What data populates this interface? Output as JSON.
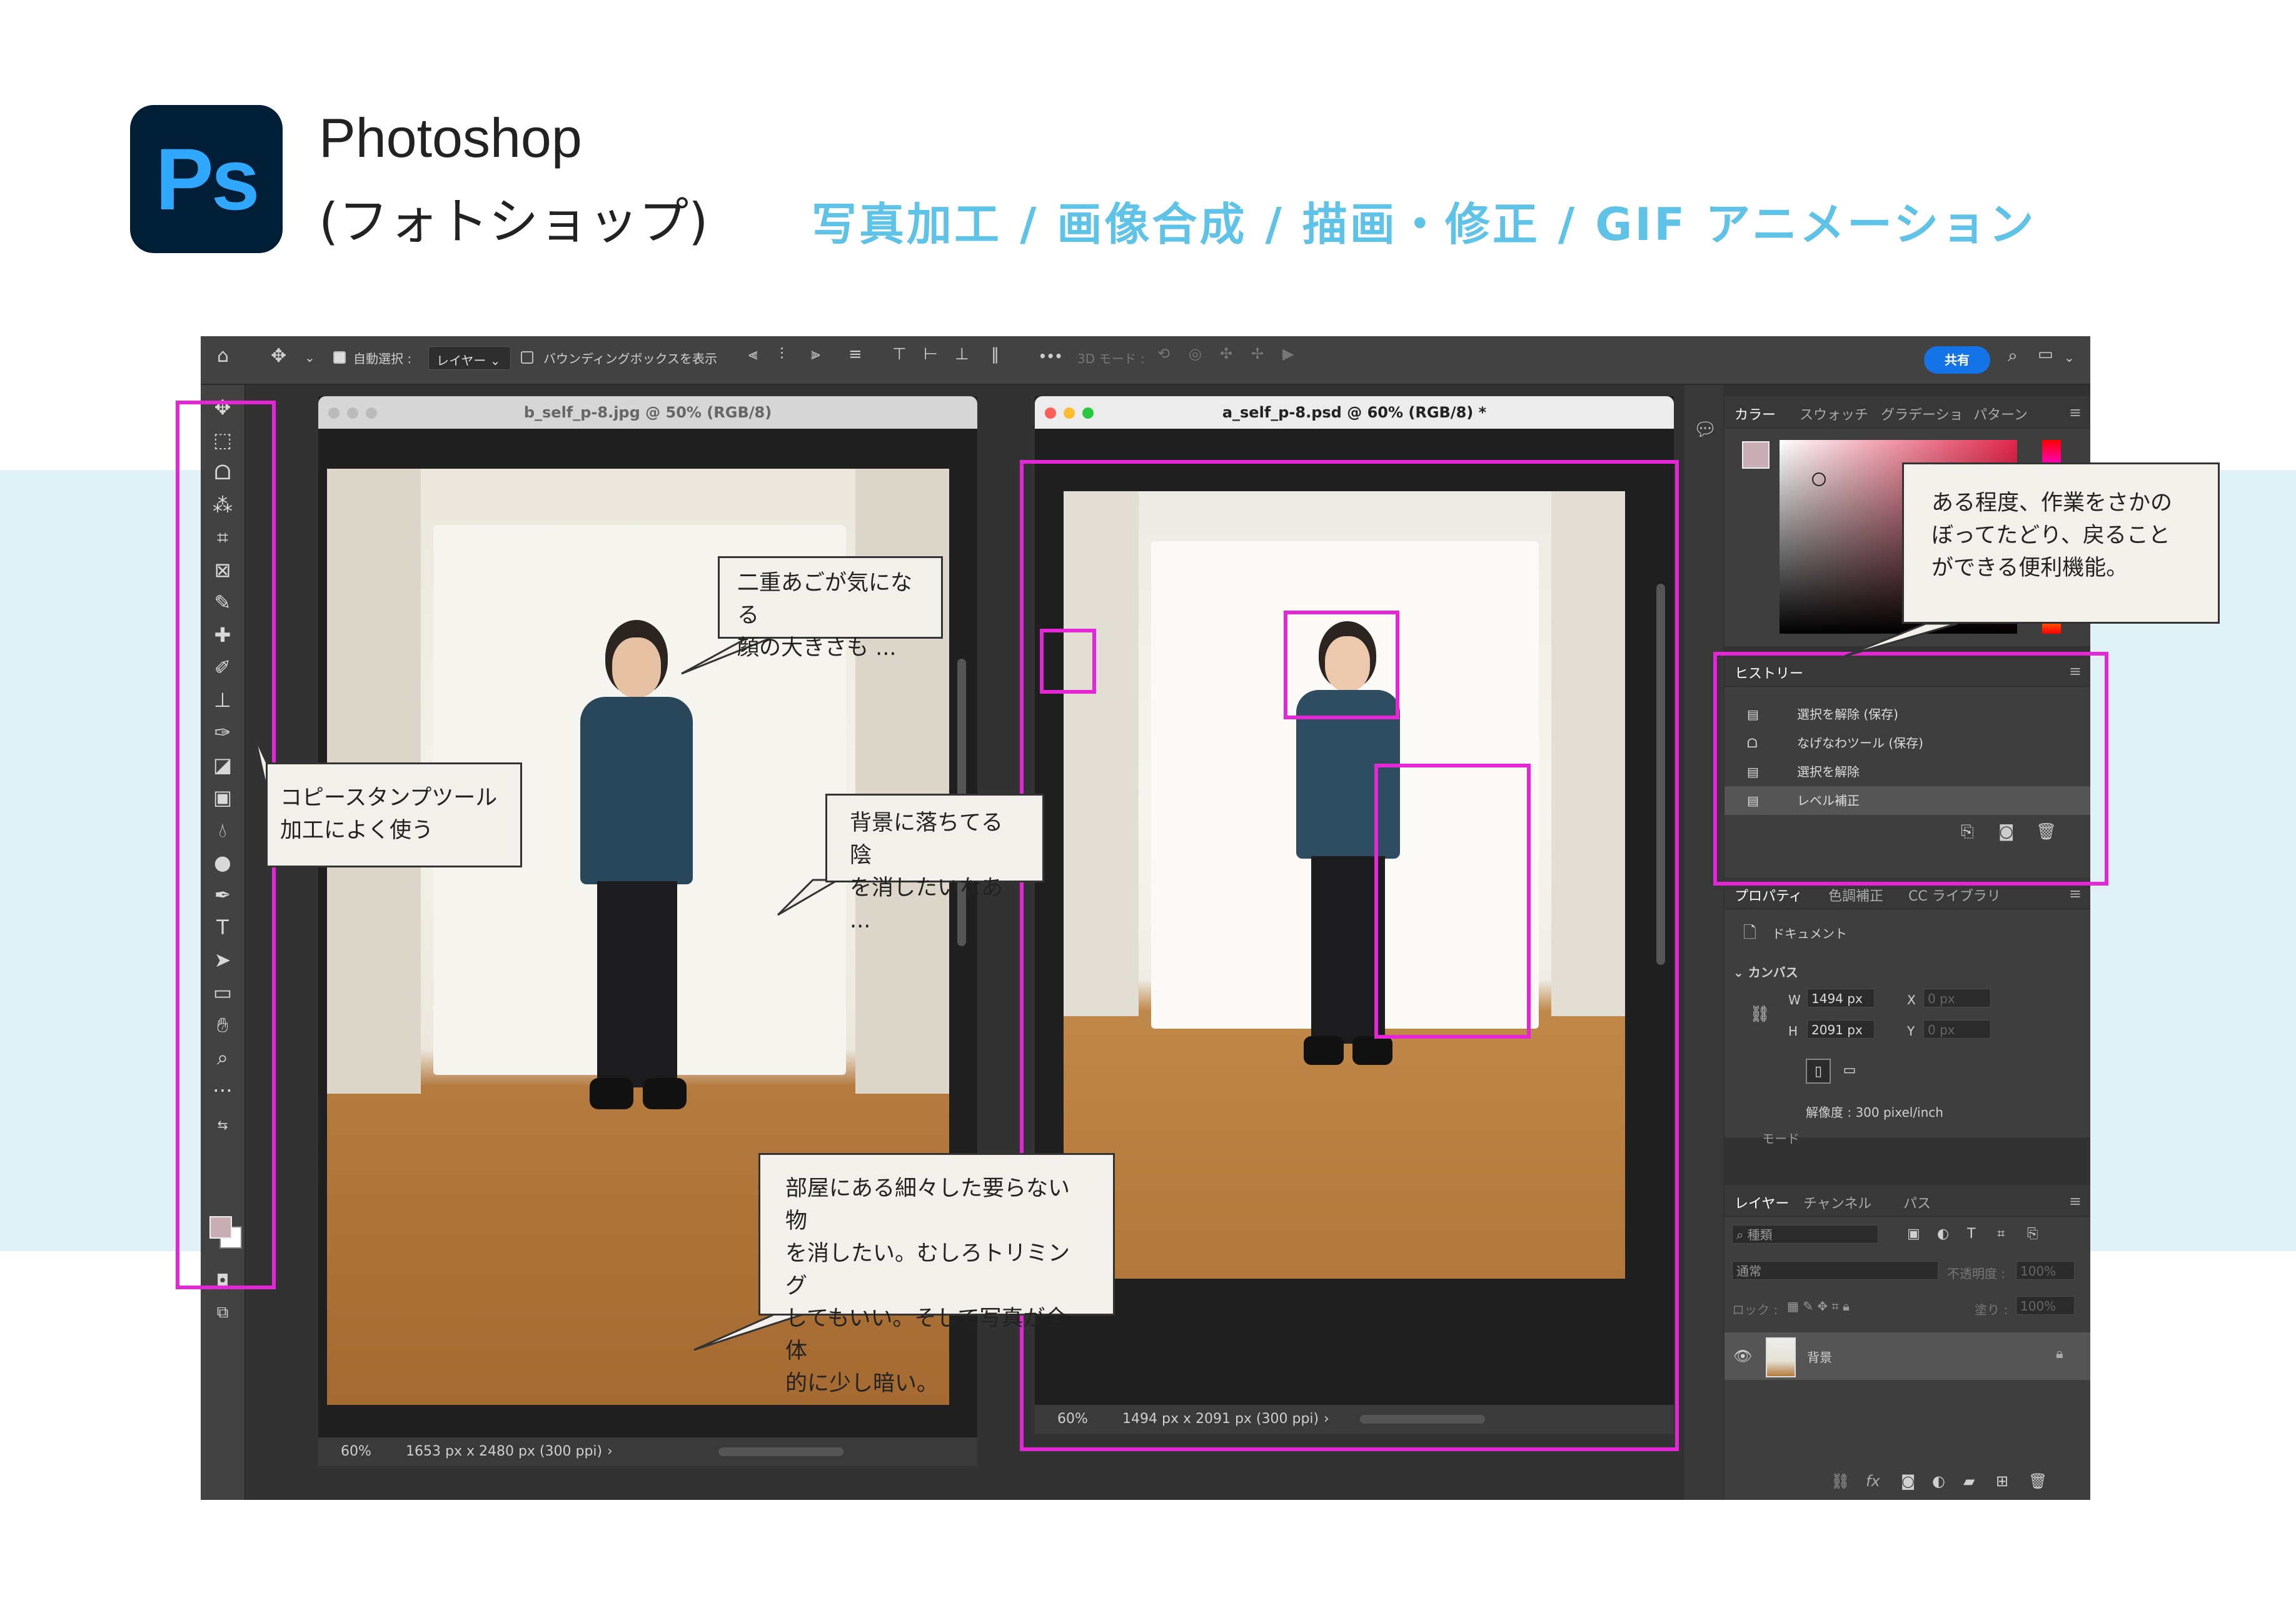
{
  "header": {
    "logo_text": "Ps",
    "app_name": "Photoshop",
    "app_name_kana": "(フォトショップ)",
    "tagline": "写真加工 / 画像合成 / 描画・修正 / GIF アニメーション",
    "tagline_color": "#5fc3e8"
  },
  "options_bar": {
    "auto_select_label": "自動選択 :",
    "auto_select_target": "レイヤー",
    "bounding_box_label": "バウンディングボックスを表示",
    "more": "•••",
    "mode_3d": "3D モード :",
    "share_label": "共有"
  },
  "documents": [
    {
      "title": "b_self_p-8.jpg @ 50% (RGB/8)",
      "zoom": "60%",
      "info": "1653 px x 2480 px (300 ppi)"
    },
    {
      "title": "a_self_p-8.psd @ 60% (RGB/8) *",
      "zoom": "60%",
      "info": "1494 px x 2091 px (300 ppi)"
    }
  ],
  "callouts": {
    "chin": "二重あごが気になる\n顔の大きさも ...",
    "stamp": "コピースタンプツール\n加工によく使う",
    "shadow": "背景に落ちてる陰\nを消したいなあ ...",
    "room": "部屋にある細々した要らない物\nを消したい。むしろトリミング\nしてもいい。そして写真が全体\n的に少し暗い。",
    "history": "ある程度、作業をさかの\nぼってたどり、戻ること\nができる便利機能。"
  },
  "color_panel": {
    "tabs": [
      "カラー",
      "スウォッチ",
      "グラデーショ",
      "パターン"
    ],
    "fg_color": "#c9aeb6"
  },
  "history_panel": {
    "title": "ヒストリー",
    "items": [
      "選択を解除 (保存)",
      "なげなわツール (保存)",
      "選択を解除",
      "レベル補正"
    ]
  },
  "properties_panel": {
    "tabs": [
      "プロパティ",
      "色調補正",
      "CC ライブラリ"
    ],
    "doc_label": "ドキュメント",
    "canvas_label": "カンバス",
    "w_label": "W",
    "w_value": "1494 px",
    "h_label": "H",
    "h_value": "2091 px",
    "x_label": "X",
    "x_value": "0 px",
    "y_label": "Y",
    "y_value": "0 px",
    "resolution": "解像度 : 300 pixel/inch",
    "mode_label": "モード"
  },
  "layers_panel": {
    "tabs": [
      "レイヤー",
      "チャンネル",
      "パス"
    ],
    "search_placeholder": "種類",
    "blend_mode": "通常",
    "opacity_label": "不透明度 :",
    "opacity_value": "100%",
    "lock_label": "ロック :",
    "fill_label": "塗り :",
    "fill_value": "100%",
    "layer_name": "背景"
  },
  "tools": [
    "move-tool",
    "marquee-tool",
    "lasso-tool",
    "quick-select-tool",
    "crop-tool",
    "frame-tool",
    "eyedropper-tool",
    "healing-brush-tool",
    "brush-tool",
    "clone-stamp-tool",
    "history-brush-tool",
    "eraser-tool",
    "gradient-tool",
    "blur-tool",
    "dodge-tool",
    "pen-tool",
    "type-tool",
    "path-select-tool",
    "shape-tool",
    "hand-tool",
    "zoom-tool",
    "edit-toolbar"
  ],
  "highlight_color": "#e526d6"
}
